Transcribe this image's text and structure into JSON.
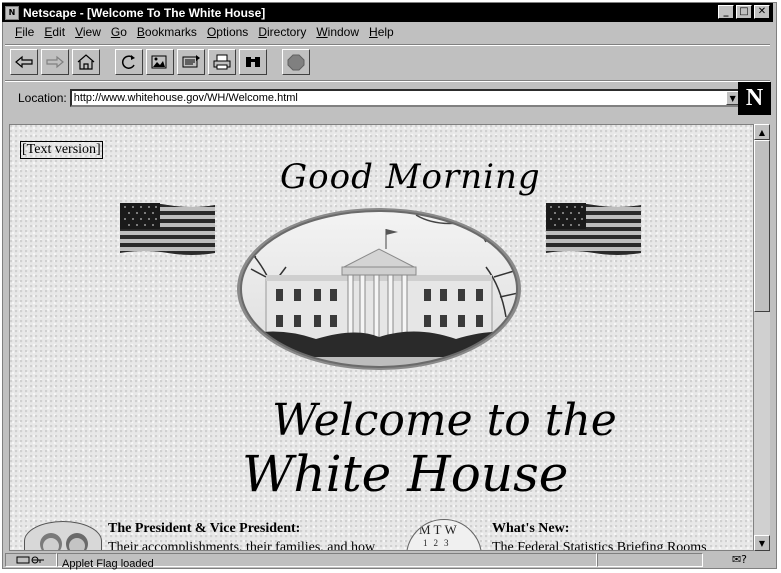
{
  "window": {
    "title": "Netscape - [Welcome To The White House]",
    "app_icon": "N"
  },
  "titlebar_buttons": {
    "minimize": "_",
    "maximize": "□",
    "close": "✕"
  },
  "menu": [
    {
      "label": "File",
      "u": "F",
      "rest": "ile"
    },
    {
      "label": "Edit",
      "u": "E",
      "rest": "dit"
    },
    {
      "label": "View",
      "u": "V",
      "rest": "iew"
    },
    {
      "label": "Go",
      "u": "G",
      "rest": "o"
    },
    {
      "label": "Bookmarks",
      "u": "B",
      "rest": "ookmarks"
    },
    {
      "label": "Options",
      "u": "O",
      "rest": "ptions"
    },
    {
      "label": "Directory",
      "u": "D",
      "rest": "irectory"
    },
    {
      "label": "Window",
      "u": "W",
      "rest": "indow"
    },
    {
      "label": "Help",
      "u": "H",
      "rest": "elp"
    }
  ],
  "toolbar": {
    "icons": [
      "back-icon",
      "forward-icon",
      "home-icon",
      "reload-icon",
      "images-icon",
      "open-icon",
      "print-icon",
      "find-icon",
      "stop-icon"
    ]
  },
  "location": {
    "label": "Location:",
    "url": "http://www.whitehouse.gov/WH/Welcome.html"
  },
  "brand_logo": "N",
  "page": {
    "text_version_link": "[Text version]",
    "greeting": "Good Morning",
    "welcome_line1": "Welcome to the",
    "welcome_line2": "White House",
    "bottom_left_title": "The President & Vice President:",
    "bottom_left_desc": "Their accomplishments, their families, and how",
    "bottom_right_title": "What's New:",
    "bottom_right_desc": "The Federal Statistics Briefing Rooms",
    "calendar_header": "MTW",
    "calendar_nums": "123"
  },
  "status": {
    "message": "Applet Flag loaded",
    "right_icons": "✉?"
  },
  "colors": {
    "chrome": "#c0c0c0",
    "titlebar": "#000000",
    "page_bg": "#e8e8e8"
  }
}
